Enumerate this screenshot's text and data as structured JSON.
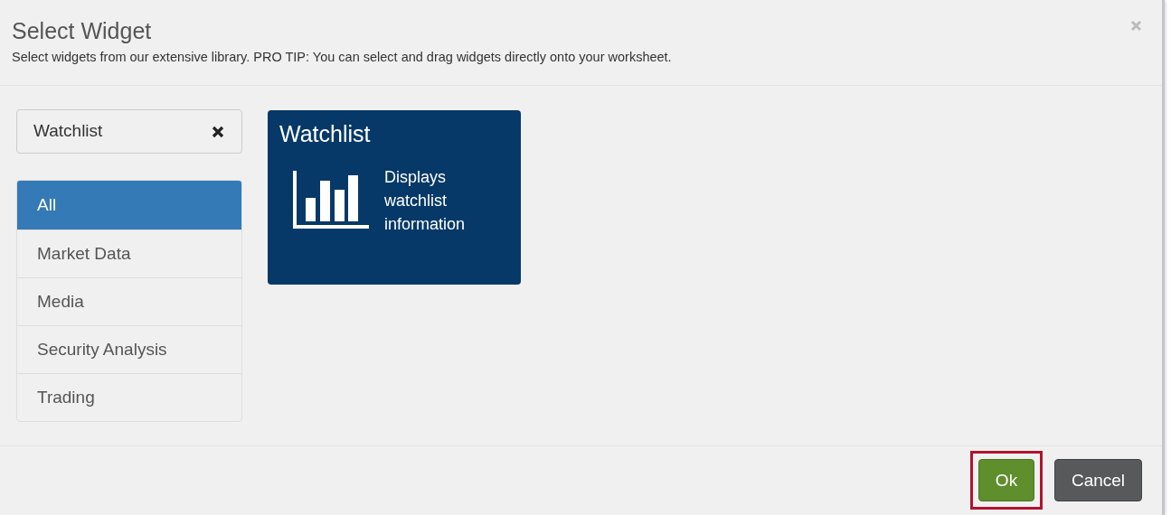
{
  "dialog": {
    "title": "Select Widget",
    "subtitle": "Select widgets from our extensive library. PRO TIP: You can select and drag widgets directly onto your worksheet."
  },
  "filter": {
    "value": "Watchlist"
  },
  "categories": [
    {
      "label": "All",
      "selected": true
    },
    {
      "label": "Market Data",
      "selected": false
    },
    {
      "label": "Media",
      "selected": false
    },
    {
      "label": "Security Analysis",
      "selected": false
    },
    {
      "label": "Trading",
      "selected": false
    }
  ],
  "widgets": [
    {
      "title": "Watchlist",
      "description": "Displays watchlist information"
    }
  ],
  "buttons": [
    {
      "label": "Ok",
      "kind": "primary",
      "highlighted": true
    },
    {
      "label": "Cancel",
      "kind": "secondary",
      "highlighted": false
    }
  ]
}
